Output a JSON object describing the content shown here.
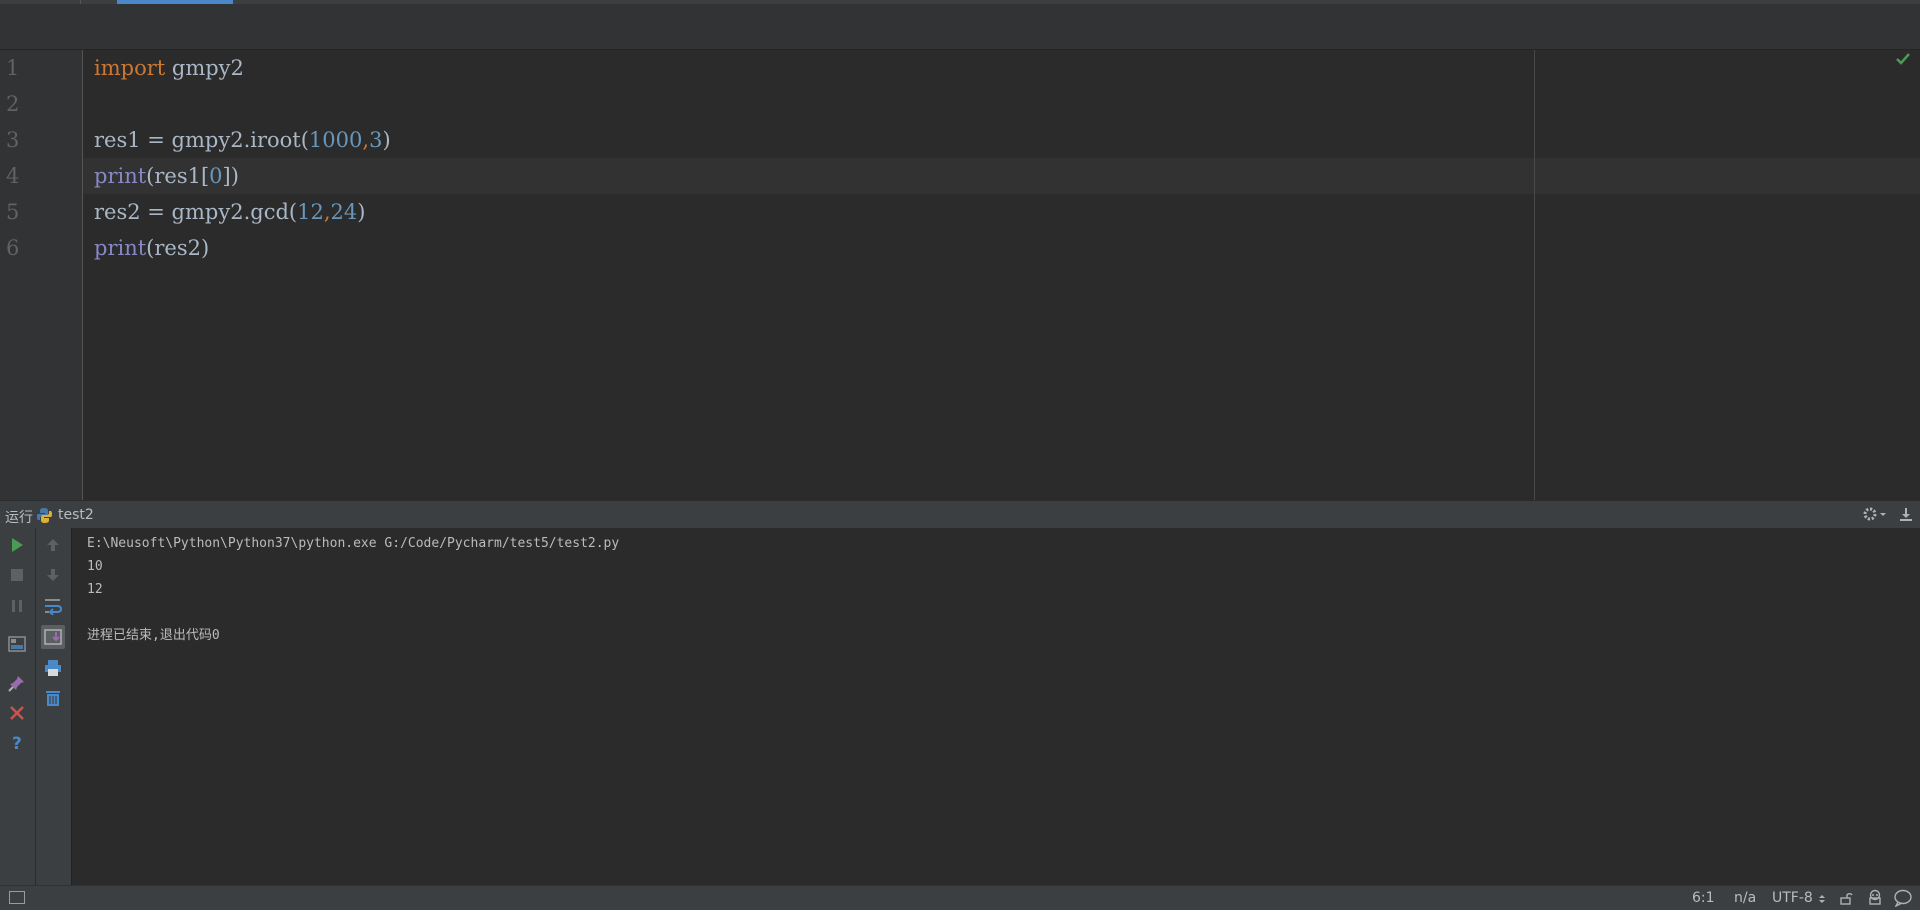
{
  "editor": {
    "line_numbers": [
      "1",
      "2",
      "3",
      "4",
      "5",
      "6"
    ],
    "lines": [
      {
        "tokens": [
          {
            "t": "import",
            "c": "kw"
          },
          {
            "t": " gmpy2",
            "c": ""
          }
        ]
      },
      {
        "tokens": []
      },
      {
        "tokens": [
          {
            "t": "res1 = gmpy2.iroot(",
            "c": ""
          },
          {
            "t": "1000",
            "c": "num"
          },
          {
            "t": ",",
            "c": "kw"
          },
          {
            "t": "3",
            "c": "num"
          },
          {
            "t": ")",
            "c": ""
          }
        ]
      },
      {
        "tokens": [
          {
            "t": "print",
            "c": "builtin"
          },
          {
            "t": "(res1[",
            "c": ""
          },
          {
            "t": "0",
            "c": "num"
          },
          {
            "t": "])",
            "c": ""
          }
        ]
      },
      {
        "tokens": [
          {
            "t": "res2 = gmpy2.gcd(",
            "c": ""
          },
          {
            "t": "12",
            "c": "num"
          },
          {
            "t": ",",
            "c": "kw"
          },
          {
            "t": "24",
            "c": "num"
          },
          {
            "t": ")",
            "c": ""
          }
        ]
      },
      {
        "tokens": [
          {
            "t": "print",
            "c": "builtin"
          },
          {
            "t": "(res2)",
            "c": ""
          }
        ]
      }
    ]
  },
  "run_panel": {
    "label": "运行",
    "config_name": "test2",
    "console_lines": [
      "E:\\Neusoft\\Python\\Python37\\python.exe G:/Code/Pycharm/test5/test2.py",
      "10",
      "12",
      "",
      "进程已结束,退出代码0"
    ]
  },
  "status_bar": {
    "position": "6:1",
    "na": "n/a",
    "encoding": "UTF-8"
  },
  "colors": {
    "accent": "#4a88c7",
    "keyword": "#cc7832",
    "builtin": "#8888c6",
    "number": "#6897bb",
    "text": "#a9b7c6",
    "run_green": "#499c54",
    "error_red": "#c75450"
  }
}
